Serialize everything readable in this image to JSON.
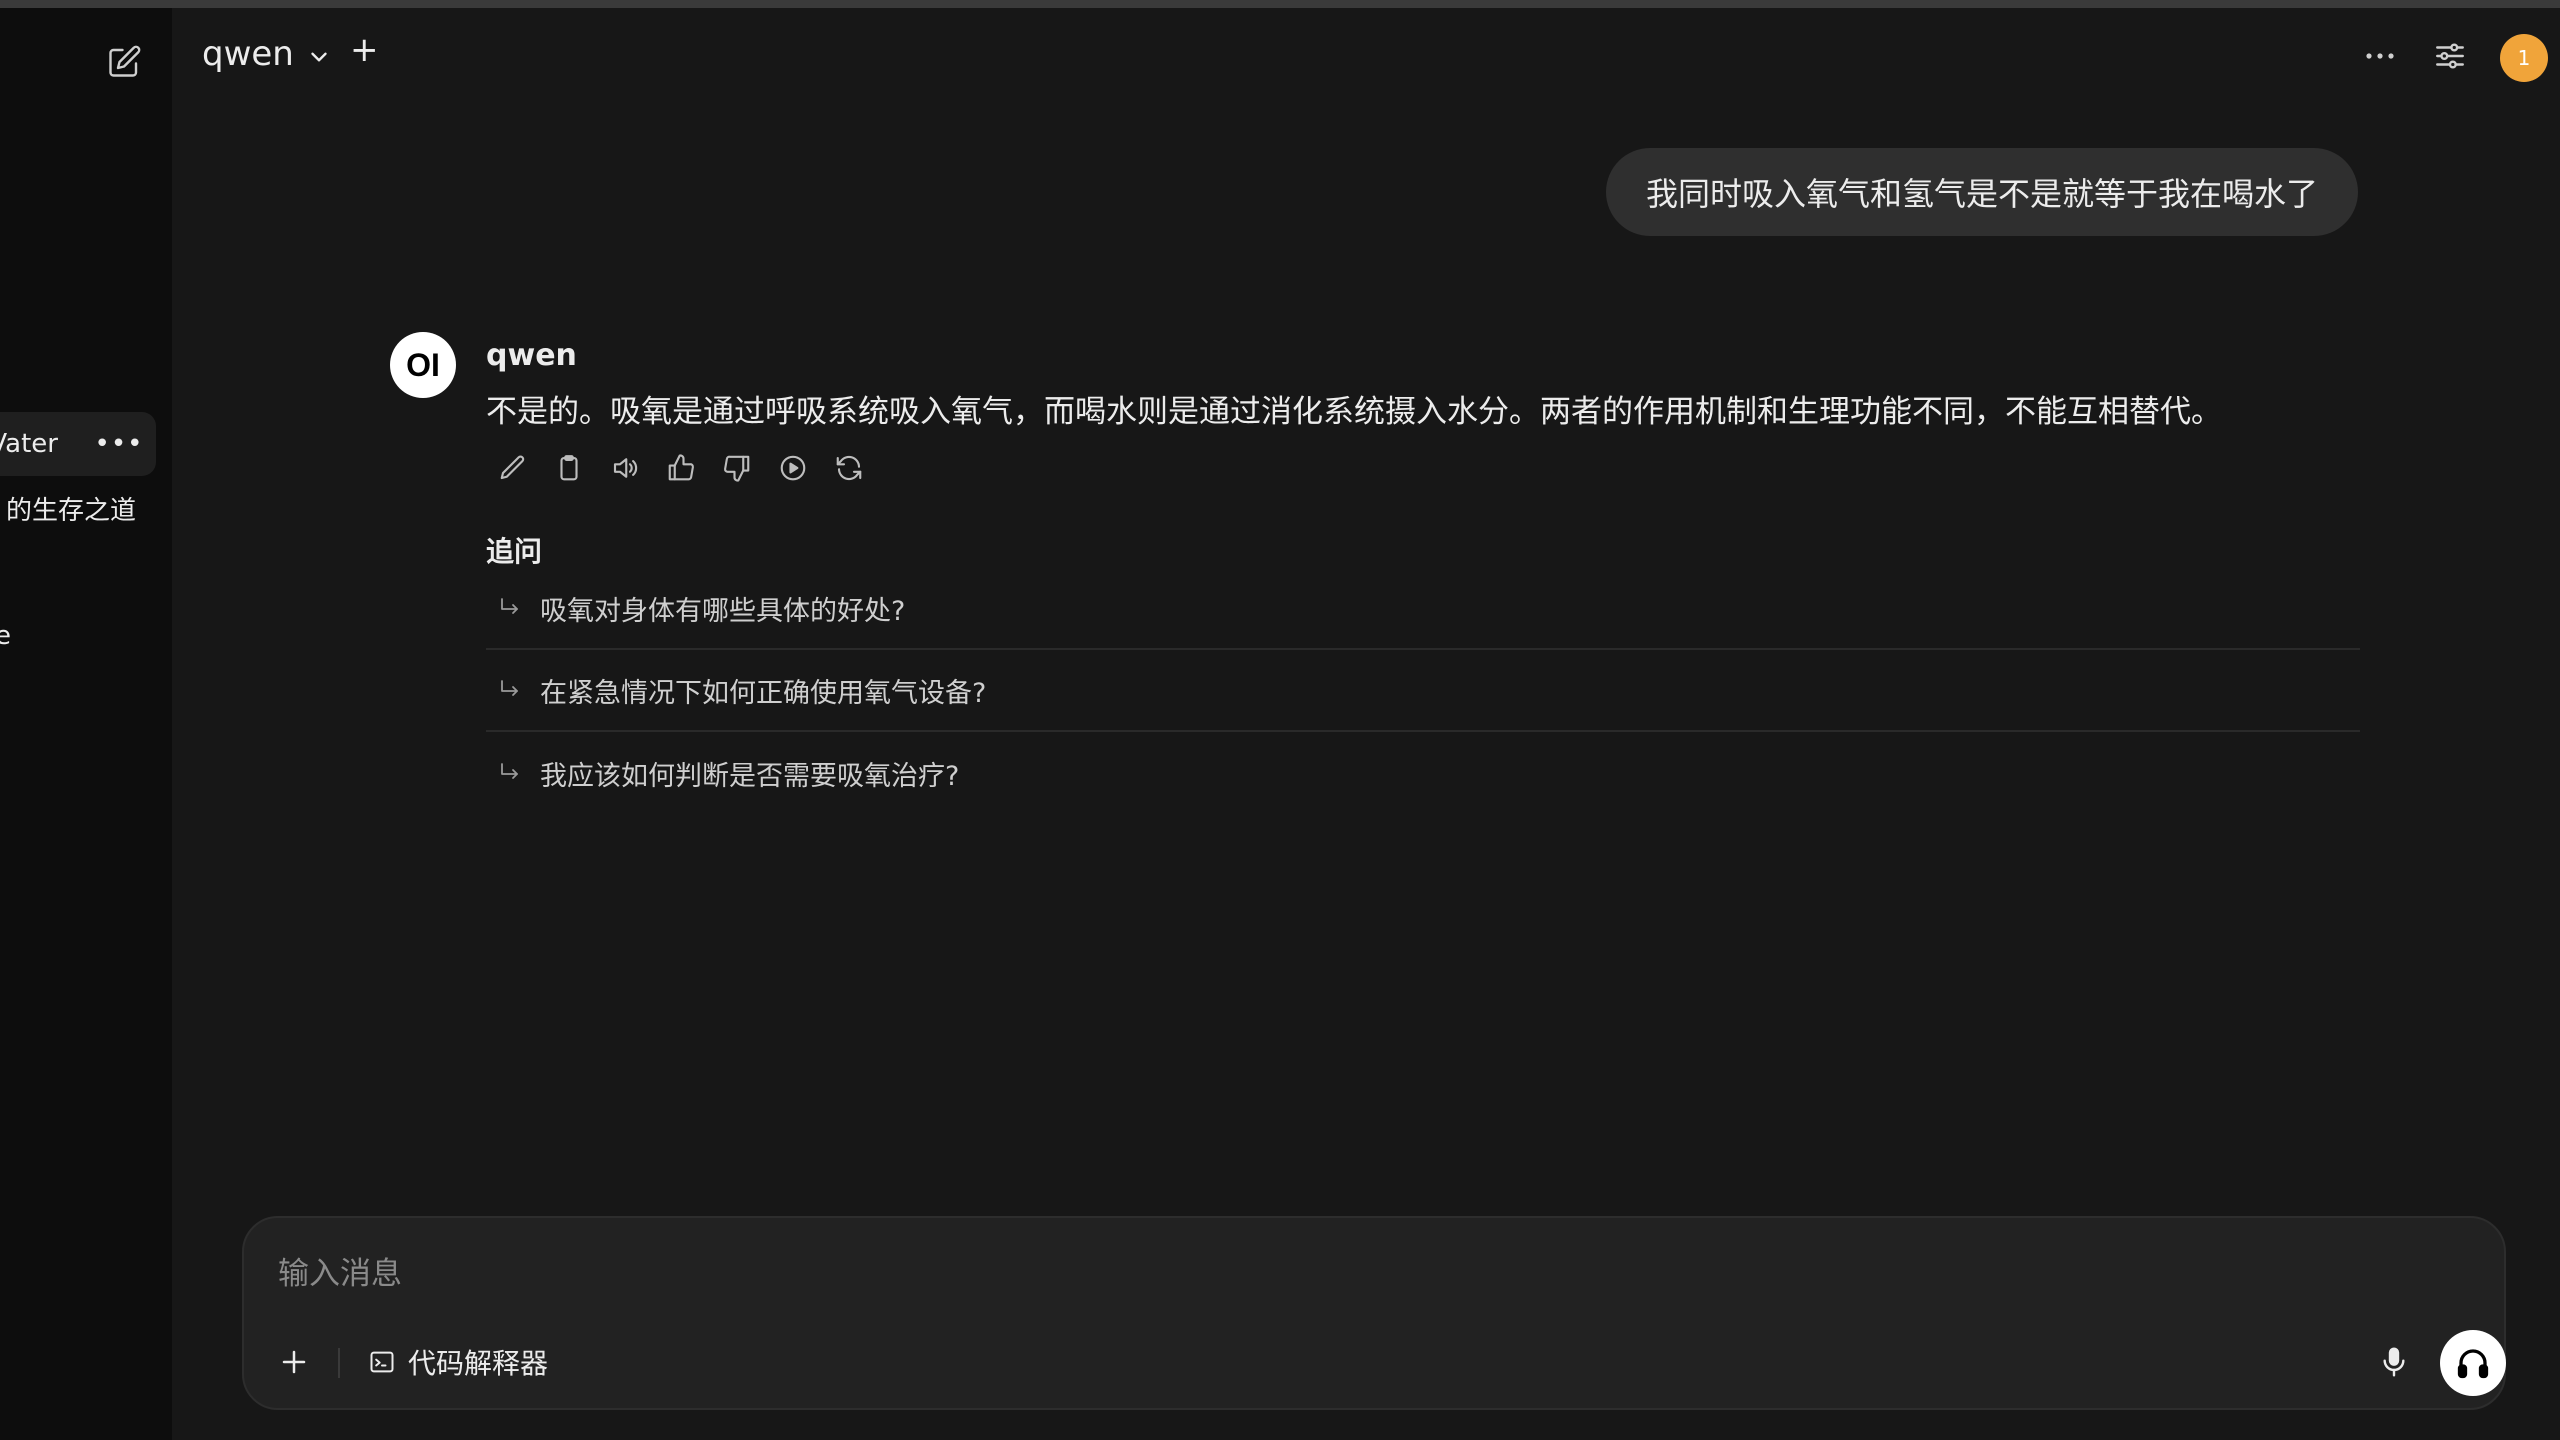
{
  "header": {
    "model_name": "qwen",
    "add_model": "+",
    "user_avatar_badge": "1",
    "avatar_color": "#f0a43a"
  },
  "sidebar": {
    "items": [
      {
        "label": "Vater"
      },
      {
        "label": "的生存之道"
      },
      {
        "label": "e"
      }
    ]
  },
  "conversation": {
    "user_message": "我同时吸入氧气和氢气是不是就等于我在喝水了",
    "assistant_avatar": "OI",
    "assistant_name": "qwen",
    "assistant_message": "不是的。吸氧是通过呼吸系统吸入氧气，而喝水则是通过消化系统摄入水分。两者的作用机制和生理功能不同，不能互相替代。",
    "actions": [
      "edit-icon",
      "copy-icon",
      "read-aloud-icon",
      "thumbs-up-icon",
      "thumbs-down-icon",
      "continue-icon",
      "regenerate-icon"
    ]
  },
  "followups": {
    "title": "追问",
    "items": [
      {
        "text": "吸氧对身体有哪些具体的好处?"
      },
      {
        "text": "在紧急情况下如何正确使用氧气设备?"
      },
      {
        "text": "我应该如何判断是否需要吸氧治疗?"
      }
    ]
  },
  "composer": {
    "placeholder": "输入消息",
    "tool_label": "代码解释器"
  }
}
